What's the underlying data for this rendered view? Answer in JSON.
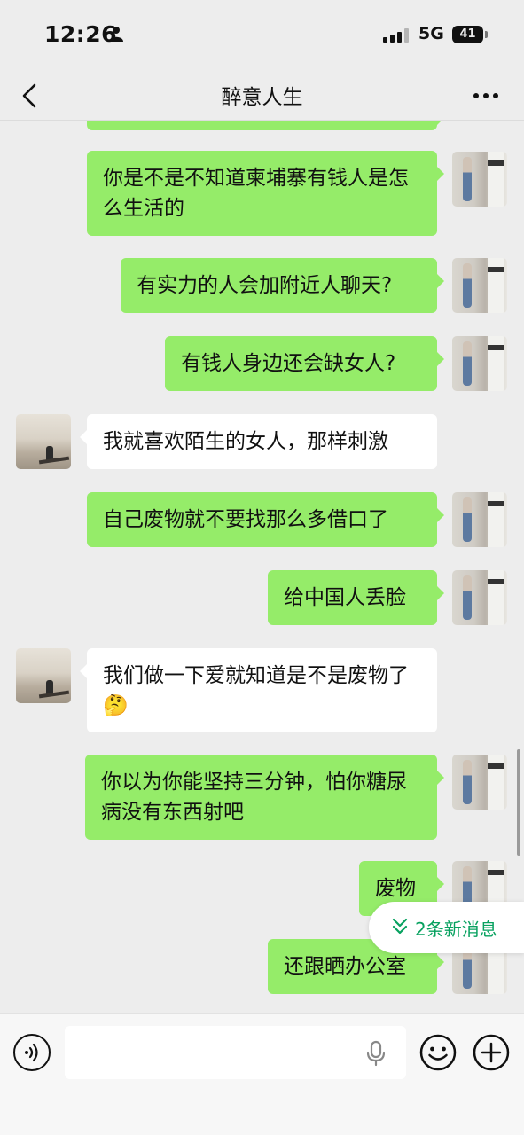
{
  "status_bar": {
    "time": "12:26",
    "network": "5G",
    "battery": "41",
    "icons": [
      "person-icon",
      "signal-icon",
      "battery-icon"
    ]
  },
  "nav": {
    "title": "醉意人生",
    "back_icon": "chevron-left-icon",
    "more_icon": "more-dots-icon"
  },
  "messages": [
    {
      "from": "me",
      "text": "你是不是不知道柬埔寨有钱人是怎么生活的"
    },
    {
      "from": "me",
      "text": "有实力的人会加附近人聊天?"
    },
    {
      "from": "me",
      "text": "有钱人身边还会缺女人?"
    },
    {
      "from": "them",
      "text": "我就喜欢陌生的女人，那样刺激"
    },
    {
      "from": "me",
      "text": "自己废物就不要找那么多借口了"
    },
    {
      "from": "me",
      "text": "给中国人丢脸"
    },
    {
      "from": "them",
      "text": "我们做一下爱就知道是不是废物了",
      "emoji": "🤔"
    },
    {
      "from": "me",
      "text": "你以为你能坚持三分钟，怕你糖尿病没有东西射吧"
    },
    {
      "from": "me",
      "text": "废物"
    },
    {
      "from": "me",
      "text": "还跟晒办公室"
    }
  ],
  "new_messages_pill": {
    "label": "2条新消息",
    "icon": "double-chevron-down-icon",
    "color": "#07a15f"
  },
  "input_bar": {
    "voice_icon": "voice-icon",
    "mic_icon": "mic-icon",
    "emoji_icon": "emoji-icon",
    "plus_icon": "plus-icon",
    "value": ""
  },
  "colors": {
    "my_bubble": "#95ec69",
    "their_bubble": "#ffffff",
    "background": "#ededed"
  }
}
